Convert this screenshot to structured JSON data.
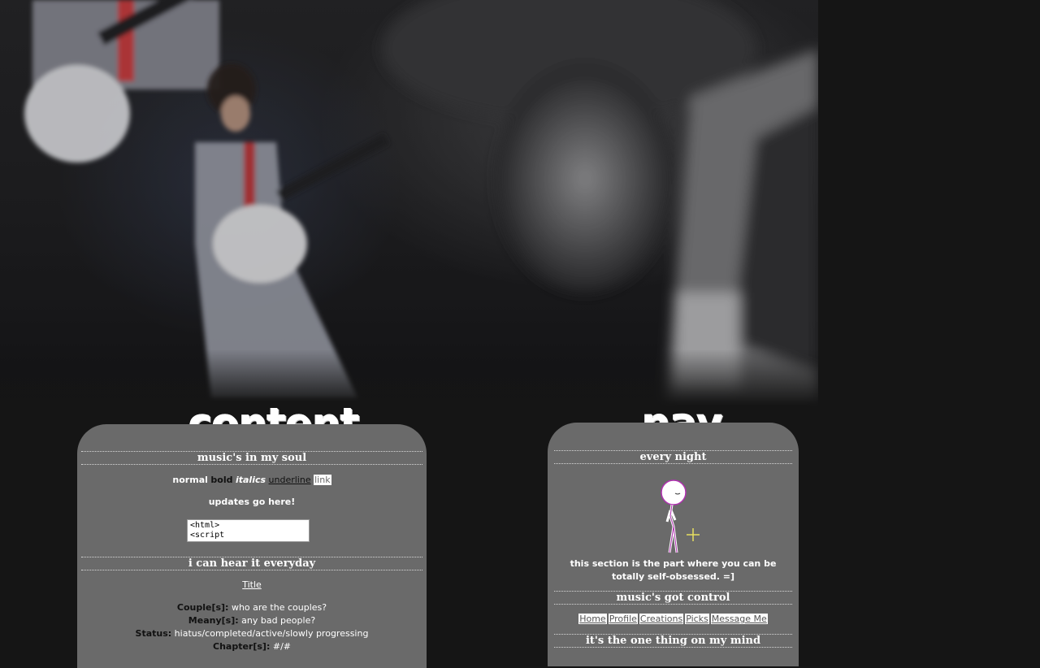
{
  "banner": {
    "description_alt": "band photo banner"
  },
  "content_box": {
    "title": "content",
    "heading1": "music's in my soul",
    "format": {
      "normal": "normal",
      "bold": "bold",
      "italics": "italics",
      "underline": "underline",
      "link": "link"
    },
    "updates": "updates go here!",
    "code_value": "<html>\n<script",
    "heading2": "i can hear it everyday",
    "story_title": "Title",
    "story_meta": [
      {
        "label": "Couple[s]:",
        "value": "who are the couples?"
      },
      {
        "label": "Meany[s]:",
        "value": "any bad people?"
      },
      {
        "label": "Status:",
        "value": "hiatus/completed/active/slowly progressing"
      },
      {
        "label": "Chapter[s]:",
        "value": "#/#"
      }
    ]
  },
  "nav_box": {
    "title": "nav.",
    "heading1": "every night",
    "self_text": "this section is the part where you can be totally self-obsessed. =]",
    "heading2": "music's got control",
    "links": [
      "Home",
      "Profile",
      "Creations",
      "Picks",
      "Message Me"
    ],
    "heading3": "it's the one thing on my mind"
  },
  "colors": {
    "page_bg": "#151515",
    "box_bg": "#6a6a6a",
    "text": "#ffffff"
  }
}
